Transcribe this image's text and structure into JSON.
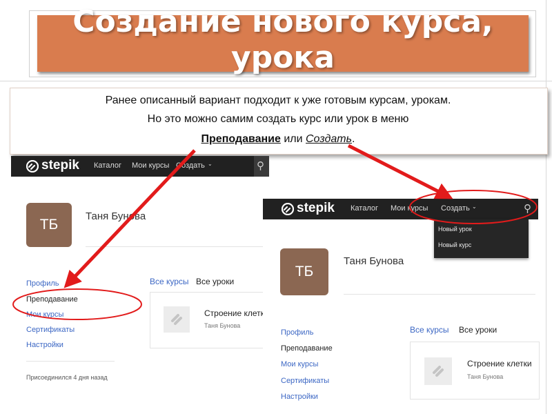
{
  "slide": {
    "title": "Создание нового курса, урока",
    "description": {
      "line1": "Ранее описанный вариант подходит к уже готовым курсам, урокам.",
      "line2": "Но это можно самим создать курс или урок в меню",
      "line3_link1": "Преподавание",
      "line3_mid": " или ",
      "line3_link2": "Создать",
      "line3_end": "."
    }
  },
  "screenshot_left": {
    "logo": "stepik",
    "nav": [
      "Каталог",
      "Мои курсы",
      "Создать"
    ],
    "avatar_initials": "ТБ",
    "user_name": "Таня Бунова",
    "sidebar": [
      "Профиль",
      "Преподавание",
      "Мои курсы",
      "Сертификаты",
      "Настройки"
    ],
    "joined_text": "Присоединился 4 дня назад",
    "tabs": [
      "Все курсы",
      "Все уроки"
    ],
    "course": {
      "title": "Строение клетки",
      "author": "Таня Бунова"
    }
  },
  "screenshot_right": {
    "logo": "stepik",
    "nav": [
      "Каталог",
      "Мои курсы",
      "Создать"
    ],
    "dropdown": [
      "Новый урок",
      "Новый курс"
    ],
    "avatar_initials": "ТБ",
    "user_name": "Таня Бунова",
    "sidebar": [
      "Профиль",
      "Преподавание",
      "Мои курсы",
      "Сертификаты",
      "Настройки"
    ],
    "tabs": [
      "Все курсы",
      "Все уроки"
    ],
    "course": {
      "title": "Строение клетки",
      "author": "Таня Бунова"
    }
  },
  "colors": {
    "title_bg": "#d97c4e",
    "annotation": "#e21b1b",
    "link": "#3c67c4",
    "navbar": "#212121",
    "avatar": "#8b6752"
  },
  "icons": [
    "stepik-logo-icon",
    "search-icon",
    "chevron-down-icon",
    "course-logo-icon"
  ]
}
